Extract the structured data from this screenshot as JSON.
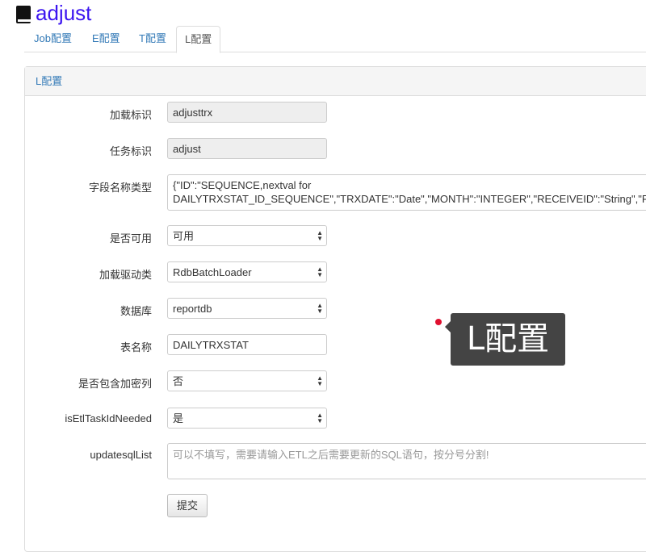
{
  "app": {
    "title": "adjust"
  },
  "tabs": [
    {
      "label": "Job配置"
    },
    {
      "label": "E配置"
    },
    {
      "label": "T配置"
    },
    {
      "label": "L配置"
    }
  ],
  "panel": {
    "heading": "L配置"
  },
  "form": {
    "load_id": {
      "label": "加载标识",
      "value": "adjusttrx"
    },
    "task_id": {
      "label": "任务标识",
      "value": "adjust"
    },
    "field_types": {
      "label": "字段名称类型",
      "line1": "{\"ID\":\"SEQUENCE,nextval for",
      "line2": "DAILYTRXSTAT_ID_SEQUENCE\",\"TRXDATE\":\"Date\",\"MONTH\":\"INTEGER\",\"RECEIVEID\":\"String\",\"PRO"
    },
    "enabled": {
      "label": "是否可用",
      "value": "可用"
    },
    "loader_class": {
      "label": "加载驱动类",
      "value": "RdbBatchLoader"
    },
    "database": {
      "label": "数据库",
      "value": "reportdb"
    },
    "table_name": {
      "label": "表名称",
      "value": "DAILYTRXSTAT"
    },
    "has_encrypted": {
      "label": "是否包含加密列",
      "value": "否"
    },
    "etl_task_id": {
      "label": "isEtlTaskIdNeeded",
      "value": "是"
    },
    "update_sql": {
      "label": "updatesqlList",
      "placeholder": "可以不填写，需要请输入ETL之后需要更新的SQL语句，按分号分割!"
    },
    "submit_label": "提交"
  },
  "tooltip": {
    "text": "L配置"
  },
  "colors": {
    "brand": "#3b14f0",
    "link": "#337ab7",
    "dot": "#e0102f"
  }
}
